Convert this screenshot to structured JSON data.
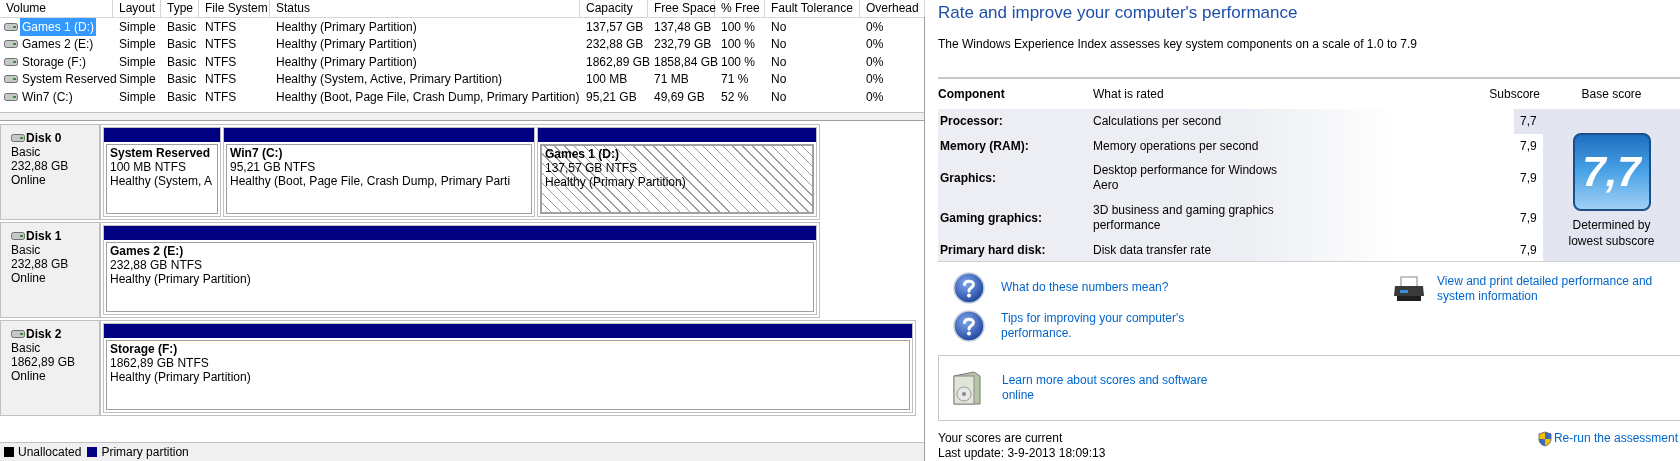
{
  "volume_table": {
    "columns": [
      "Volume",
      "Layout",
      "Type",
      "File System",
      "Status",
      "Capacity",
      "Free Space",
      "% Free",
      "Fault Tolerance",
      "Overhead"
    ],
    "rows": [
      {
        "selected": true,
        "cells": [
          "Games 1 (D:)",
          "Simple",
          "Basic",
          "NTFS",
          "Healthy (Primary Partition)",
          "137,57 GB",
          "137,48 GB",
          "100 %",
          "No",
          "0%"
        ]
      },
      {
        "selected": false,
        "cells": [
          "Games 2 (E:)",
          "Simple",
          "Basic",
          "NTFS",
          "Healthy (Primary Partition)",
          "232,88 GB",
          "232,79 GB",
          "100 %",
          "No",
          "0%"
        ]
      },
      {
        "selected": false,
        "cells": [
          "Storage (F:)",
          "Simple",
          "Basic",
          "NTFS",
          "Healthy (Primary Partition)",
          "1862,89 GB",
          "1858,84 GB",
          "100 %",
          "No",
          "0%"
        ]
      },
      {
        "selected": false,
        "cells": [
          "System Reserved",
          "Simple",
          "Basic",
          "NTFS",
          "Healthy (System, Active, Primary Partition)",
          "100 MB",
          "71 MB",
          "71 %",
          "No",
          "0%"
        ]
      },
      {
        "selected": false,
        "cells": [
          "Win7 (C:)",
          "Simple",
          "Basic",
          "NTFS",
          "Healthy (Boot, Page File, Crash Dump, Primary Partition)",
          "95,21 GB",
          "49,69 GB",
          "52 %",
          "No",
          "0%"
        ]
      }
    ]
  },
  "disks": [
    {
      "name": "Disk 0",
      "type": "Basic",
      "size": "232,88 GB",
      "status": "Online",
      "partitions": [
        {
          "name": "System Reserved",
          "size": "100 MB NTFS",
          "status": "Healthy (System, A",
          "selected": false
        },
        {
          "name": "Win7  (C:)",
          "size": "95,21 GB NTFS",
          "status": "Healthy (Boot, Page File, Crash Dump, Primary Parti",
          "selected": false
        },
        {
          "name": "Games 1  (D:)",
          "size": "137,57 GB NTFS",
          "status": "Healthy (Primary Partition)",
          "selected": true
        }
      ]
    },
    {
      "name": "Disk 1",
      "type": "Basic",
      "size": "232,88 GB",
      "status": "Online",
      "partitions": [
        {
          "name": "Games 2  (E:)",
          "size": "232,88 GB NTFS",
          "status": "Healthy (Primary Partition)",
          "selected": false
        }
      ]
    },
    {
      "name": "Disk 2",
      "type": "Basic",
      "size": "1862,89 GB",
      "status": "Online",
      "partitions": [
        {
          "name": "Storage  (F:)",
          "size": "1862,89 GB NTFS",
          "status": "Healthy (Primary Partition)",
          "selected": false
        }
      ]
    }
  ],
  "legend": [
    {
      "label": "Unallocated",
      "color": "#000000"
    },
    {
      "label": "Primary partition",
      "color": "#000080"
    }
  ],
  "performance": {
    "title": "Rate and improve your computer's performance",
    "description": "The Windows Experience Index assesses key system components on a scale of 1.0 to 7.9",
    "columns": [
      "Component",
      "What is rated",
      "Subscore",
      "Base score"
    ],
    "rows": [
      {
        "component": "Processor:",
        "rated": "Calculations per second",
        "subscore": "7,7",
        "selected": true
      },
      {
        "component": "Memory (RAM):",
        "rated": "Memory operations per second",
        "subscore": "7,9",
        "selected": false
      },
      {
        "component": "Graphics:",
        "rated": "Desktop performance for Windows Aero",
        "subscore": "7,9",
        "selected": false
      },
      {
        "component": "Gaming graphics:",
        "rated": "3D business and gaming graphics performance",
        "subscore": "7,9",
        "selected": false
      },
      {
        "component": "Primary hard disk:",
        "rated": "Disk data transfer rate",
        "subscore": "7,9",
        "selected": false
      }
    ],
    "base_score": "7,7",
    "base_note": "Determined by lowest subscore",
    "help_links": [
      "What do these numbers mean?",
      "Tips for improving your computer's performance."
    ],
    "print_link": "View and print detailed performance and system information",
    "online_link": "Learn more about scores and software online",
    "status": "Your scores are current",
    "last_update": "Last update: 3-9-2013 18:09:13",
    "rerun_link": "Re-run the assessment"
  }
}
